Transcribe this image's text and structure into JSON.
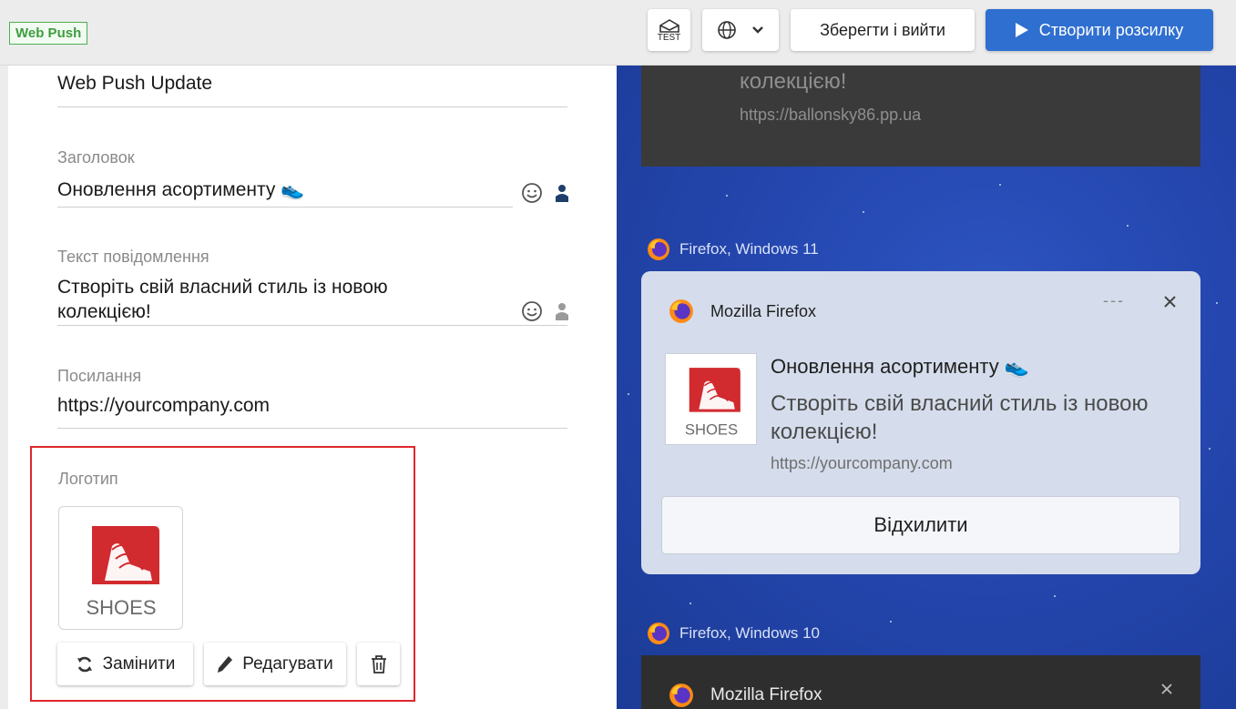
{
  "topbar": {
    "badge": "Web Push",
    "test_label": "TEST",
    "save_label": "Зберегти і вийти",
    "create_label": "Створити розсилку"
  },
  "form": {
    "name_value": "Web Push Update",
    "title_label": "Заголовок",
    "title_value": "Оновлення асортименту 👟",
    "message_label": "Текст повідомлення",
    "message_value": "Створіть свій власний стиль із новою колекцією!",
    "link_label": "Посилання",
    "link_value": "https://yourcompany.com",
    "logo_label": "Логотип",
    "logo_text": "SHOES",
    "replace_label": "Замінити",
    "edit_label": "Редагувати"
  },
  "preview": {
    "prev_text": "колекцією!",
    "prev_url": "https://ballonsky86.pp.ua",
    "platform_1": "Firefox, Windows 11",
    "app_name": "Mozilla Firefox",
    "more_label": "---",
    "notif_title": "Оновлення асортименту 👟",
    "notif_body": "Створіть свій власний стиль із новою колекцією!",
    "notif_url": "https://yourcompany.com",
    "dismiss_label": "Відхилити",
    "platform_2": "Firefox, Windows 10",
    "app_name_2": "Mozilla Firefox"
  },
  "colors": {
    "accent_blue": "#2f6fd0",
    "highlight_red": "#e0262b",
    "badge_green": "#4caf50"
  }
}
